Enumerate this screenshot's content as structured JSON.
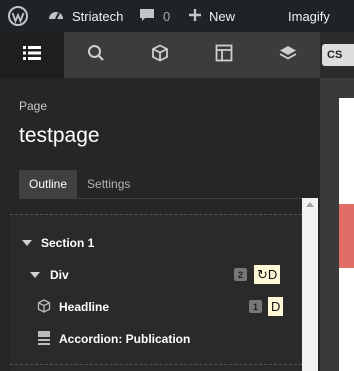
{
  "admin_bar": {
    "site_name": "Striatech",
    "comments_count": "0",
    "new_label": "New",
    "imagify_label": "Imagify"
  },
  "toolbar": {
    "tools": [
      "outline-list",
      "search",
      "components",
      "layout",
      "layers"
    ],
    "active": "outline-list"
  },
  "canvas": {
    "badge": "CS"
  },
  "panel": {
    "label": "Page",
    "title": "testpage",
    "tabs": [
      {
        "label": "Outline",
        "active": true
      },
      {
        "label": "Settings",
        "active": false
      }
    ]
  },
  "outline": [
    {
      "label": "Section 1",
      "level": 0,
      "icon": "caret-down"
    },
    {
      "label": "Div",
      "level": 1,
      "icon": "caret-down",
      "count": "2",
      "chip": "↻D"
    },
    {
      "label": "Headline",
      "level": 2,
      "icon": "cube",
      "count": "1",
      "chip": "D"
    },
    {
      "label": "Accordion: Publication",
      "level": 2,
      "icon": "accordion"
    }
  ],
  "colors": {
    "admin_bar_bg": "#1d2327",
    "toolbar_bg": "#3c3c3c",
    "panel_bg": "#262626",
    "chip_bg": "#fff8d7",
    "canvas_accent": "#e06c66"
  }
}
